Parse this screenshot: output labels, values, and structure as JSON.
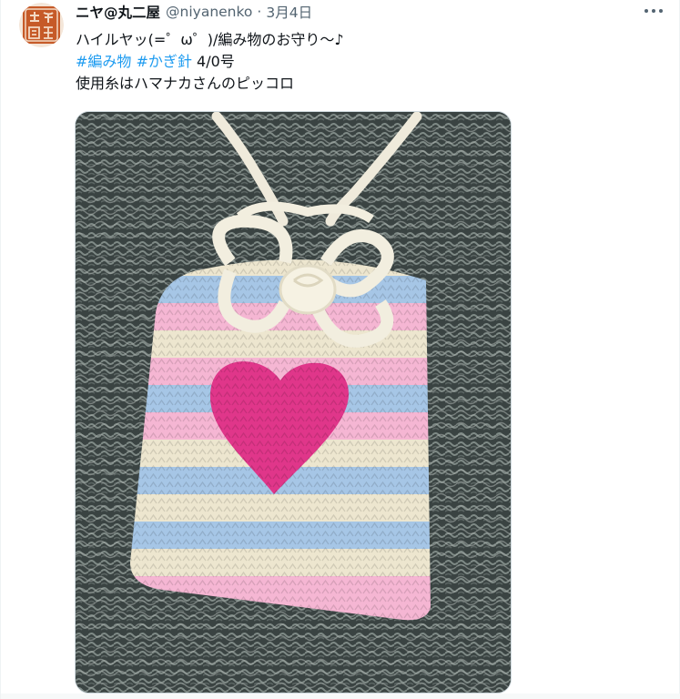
{
  "tweet": {
    "author": {
      "display_name": "ニヤ@丸二屋",
      "handle": "@niyanenko",
      "avatar_icon": "orange-seal-avatar"
    },
    "separator": "·",
    "date": "3月4日",
    "more_icon": "more-dots-icon",
    "lines": {
      "line1": "ハイルヤッ(=゜ω゜)/編み物のお守り～♪",
      "hashtag1": "#編み物",
      "hashtag2": "#かぎ針",
      "hook_size": "4/0号",
      "line3": "使用糸はハマナカさんのピッコロ"
    },
    "media": {
      "type": "photo",
      "subject": "crochet-omamori-heart-pouch"
    },
    "colors": {
      "hashtag": "#1d9bf0",
      "secondary_text": "#536471",
      "avatar_bg": "#c85a2a"
    }
  }
}
